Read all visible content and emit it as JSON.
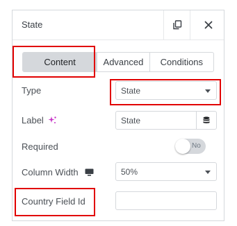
{
  "header": {
    "title": "State",
    "copy_icon": "copy-icon",
    "close_icon": "close-icon"
  },
  "tabs": [
    {
      "label": "Content",
      "active": true
    },
    {
      "label": "Advanced",
      "active": false
    },
    {
      "label": "Conditions",
      "active": false
    }
  ],
  "fields": {
    "type": {
      "label": "Type",
      "value": "State"
    },
    "label": {
      "label": "Label",
      "value": "State",
      "ai_icon": "sparkle-icon",
      "db_icon": "database-icon"
    },
    "required": {
      "label": "Required",
      "toggle_text": "No",
      "on": false
    },
    "column_width": {
      "label": "Column Width",
      "device_icon": "desktop-icon",
      "value": "50%"
    },
    "country_field_id": {
      "label": "Country Field Id",
      "value": ""
    }
  },
  "colors": {
    "highlight": "#e10000",
    "accent_pink": "#c736c7"
  }
}
